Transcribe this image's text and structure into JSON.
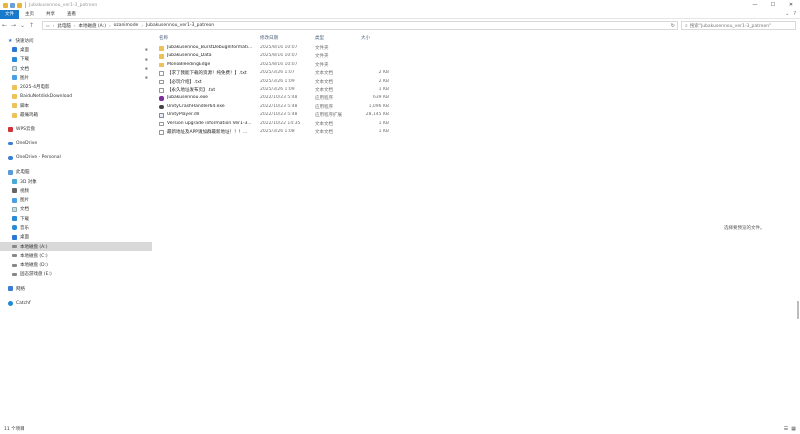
{
  "window": {
    "title": "Jubakusennou_ver1-3_patreon",
    "controls": [
      "—",
      "☐",
      "✕"
    ]
  },
  "ribbon": {
    "tabs": [
      "文件",
      "主页",
      "共享",
      "查看"
    ]
  },
  "address": {
    "segments": [
      "此电脑",
      "本地磁盘 (A:)",
      "ozanimode",
      "Jubakusennou_ver1-3_patreon"
    ],
    "search_placeholder": "搜索\"Jubakusennou_ver1-3_patreon\""
  },
  "sidebar": {
    "items": [
      {
        "label": "快速访问",
        "icon": "star-icon",
        "pinned": false
      },
      {
        "label": "桌面",
        "icon": "desktop-icon",
        "pinned": true
      },
      {
        "label": "下载",
        "icon": "download-icon",
        "pinned": true
      },
      {
        "label": "文档",
        "icon": "document-icon",
        "pinned": true
      },
      {
        "label": "图片",
        "icon": "picture-icon",
        "pinned": true
      },
      {
        "label": "2025-4月电影",
        "icon": "folder-icon",
        "pinned": false
      },
      {
        "label": "BaiduNetdiskDownload",
        "icon": "folder-icon",
        "pinned": false
      },
      {
        "label": "脚本",
        "icon": "folder-icon",
        "pinned": false
      },
      {
        "label": "最痛鸡箱",
        "icon": "folder-icon",
        "pinned": false
      },
      {
        "label": "WPS云盘",
        "icon": "wps-cloud-icon",
        "pinned": false
      },
      {
        "label": "OneDrive",
        "icon": "onedrive-icon",
        "pinned": false
      },
      {
        "label": "OneDrive - Personal",
        "icon": "onedrive-icon",
        "pinned": false
      },
      {
        "label": "此电脑",
        "icon": "this-pc-icon",
        "pinned": false
      },
      {
        "label": "3D 对象",
        "icon": "3d-objects-icon",
        "pinned": false
      },
      {
        "label": "视频",
        "icon": "video-icon",
        "pinned": false
      },
      {
        "label": "图片",
        "icon": "picture-icon",
        "pinned": false
      },
      {
        "label": "文档",
        "icon": "document-icon",
        "pinned": false
      },
      {
        "label": "下载",
        "icon": "download-icon",
        "pinned": false
      },
      {
        "label": "音乐",
        "icon": "music-icon",
        "pinned": false
      },
      {
        "label": "桌面",
        "icon": "desktop-icon",
        "pinned": false
      },
      {
        "label": "本地磁盘 (A:)",
        "icon": "drive-icon",
        "pinned": false,
        "selected": true
      },
      {
        "label": "本地磁盘 (C:)",
        "icon": "drive-icon",
        "pinned": false
      },
      {
        "label": "本地磁盘 (D:)",
        "icon": "drive-icon",
        "pinned": false
      },
      {
        "label": "固态游戏盘 (E:)",
        "icon": "drive-icon",
        "pinned": false
      },
      {
        "label": "网络",
        "icon": "network-icon",
        "pinned": false
      },
      {
        "label": "Catchf",
        "icon": "catch-icon",
        "pinned": false
      }
    ]
  },
  "columns": {
    "name": "名称",
    "date": "修改日期",
    "type": "类型",
    "size": "大小"
  },
  "files": [
    {
      "name": "Jubakusennou_BurstDebugInformati...",
      "date": "2025/8/16 10:07",
      "type": "文件夹",
      "size": "",
      "icon": "folder-icon"
    },
    {
      "name": "Jubakusennou_Data",
      "date": "2025/8/16 10:07",
      "type": "文件夹",
      "size": "",
      "icon": "folder-icon"
    },
    {
      "name": "MonoBleedingEdge",
      "date": "2025/8/16 10:07",
      "type": "文件夹",
      "size": "",
      "icon": "folder-icon"
    },
    {
      "name": "【求了我能下载的资源！纯免费！】.txt",
      "date": "2025/3/26 1:07",
      "type": "文本文档",
      "size": "2 KB",
      "icon": "text-file-icon"
    },
    {
      "name": "【必玩介绍】.txt",
      "date": "2025/3/26 1:09",
      "type": "文本文档",
      "size": "2 KB",
      "icon": "text-file-icon"
    },
    {
      "name": "【永久地址发布页】.txt",
      "date": "2025/3/26 1:09",
      "type": "文本文档",
      "size": "1 KB",
      "icon": "text-file-icon"
    },
    {
      "name": "Jubakusennou.exe",
      "date": "2022/10/23 5:48",
      "type": "应用程序",
      "size": "639 KB",
      "icon": "exe-icon"
    },
    {
      "name": "UnityCrashHandler64.exe",
      "date": "2022/10/23 5:48",
      "type": "应用程序",
      "size": "1,096 KB",
      "icon": "exe-icon"
    },
    {
      "name": "UnityPlayer.dll",
      "date": "2022/10/23 5:48",
      "type": "应用程序扩展",
      "size": "28,145 KB",
      "icon": "dll-icon"
    },
    {
      "name": "Version upgrade information Ver1-3...",
      "date": "2022/10/22 14:35",
      "type": "文本文档",
      "size": "1 KB",
      "icon": "text-file-icon"
    },
    {
      "name": "最新地址及APP请加群最新地址！！！...",
      "date": "2025/3/26 1:08",
      "type": "文本文档",
      "size": "1 KB",
      "icon": "text-file-icon"
    }
  ],
  "preview_text": "选择要预览的文件。",
  "status": {
    "count": "11 个项目"
  }
}
